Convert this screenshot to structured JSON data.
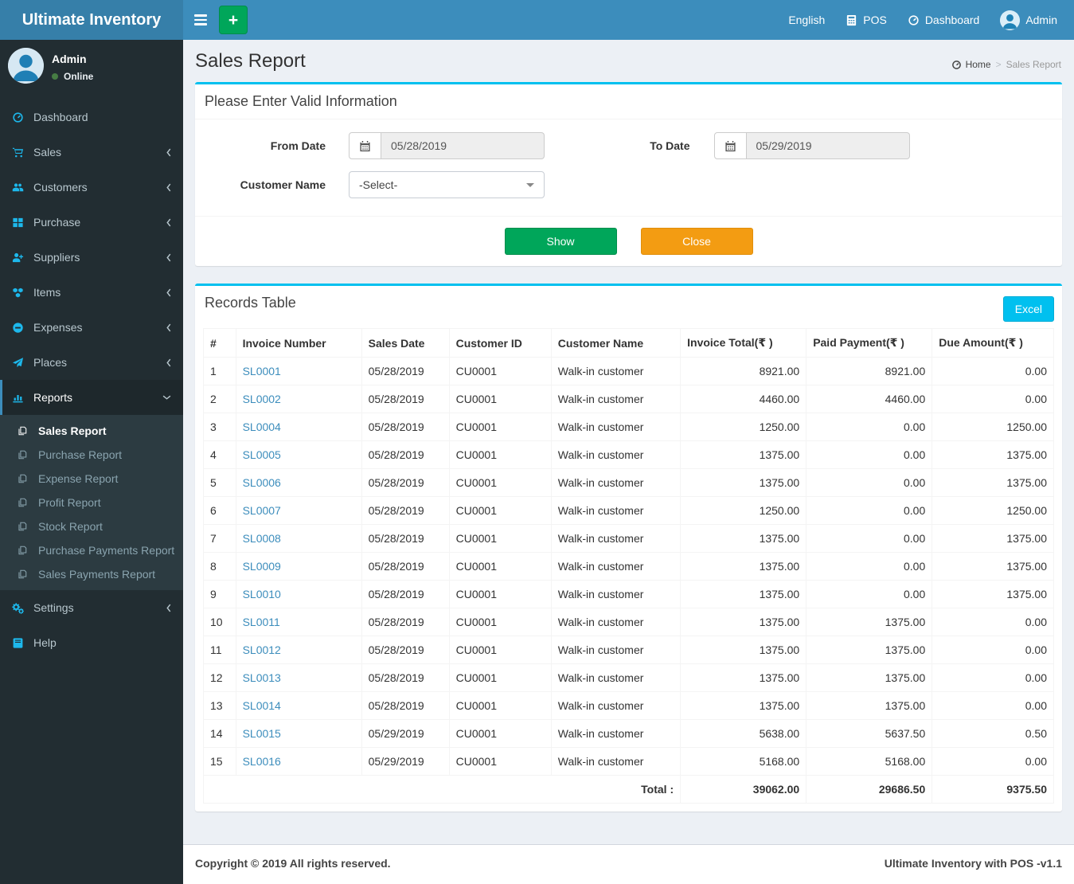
{
  "navbar": {
    "brand": "Ultimate Inventory",
    "right": {
      "language": "English",
      "pos": "POS",
      "dashboard": "Dashboard",
      "user": "Admin"
    }
  },
  "sidebar": {
    "user_name": "Admin",
    "user_status": "Online",
    "menu": [
      {
        "label": "Dashboard",
        "icon": "tachometer-icon",
        "expandable": false
      },
      {
        "label": "Sales",
        "icon": "cart-icon",
        "expandable": true
      },
      {
        "label": "Customers",
        "icon": "users-icon",
        "expandable": true
      },
      {
        "label": "Purchase",
        "icon": "grid-icon",
        "expandable": true
      },
      {
        "label": "Suppliers",
        "icon": "user-plus-icon",
        "expandable": true
      },
      {
        "label": "Items",
        "icon": "cubes-icon",
        "expandable": true
      },
      {
        "label": "Expenses",
        "icon": "minus-circle-icon",
        "expandable": true
      },
      {
        "label": "Places",
        "icon": "send-icon",
        "expandable": true
      },
      {
        "label": "Reports",
        "icon": "bar-chart-icon",
        "expandable": true,
        "active": true,
        "expanded": true,
        "submenu": [
          {
            "label": "Sales Report",
            "active": true
          },
          {
            "label": "Purchase Report"
          },
          {
            "label": "Expense Report"
          },
          {
            "label": "Profit Report"
          },
          {
            "label": "Stock Report"
          },
          {
            "label": "Purchase Payments Report"
          },
          {
            "label": "Sales Payments Report"
          }
        ]
      },
      {
        "label": "Settings",
        "icon": "gears-icon",
        "expandable": true
      },
      {
        "label": "Help",
        "icon": "book-icon",
        "expandable": false
      }
    ]
  },
  "page": {
    "title": "Sales Report",
    "breadcrumb": {
      "home": "Home",
      "current": "Sales Report"
    }
  },
  "filter_box": {
    "header": "Please Enter Valid Information",
    "from_date_label": "From Date",
    "from_date_value": "05/28/2019",
    "to_date_label": "To Date",
    "to_date_value": "05/29/2019",
    "customer_label": "Customer Name",
    "customer_value": "-Select-",
    "show_button": "Show",
    "close_button": "Close"
  },
  "records_box": {
    "header": "Records Table",
    "excel_button": "Excel",
    "columns": [
      "#",
      "Invoice Number",
      "Sales Date",
      "Customer ID",
      "Customer Name",
      "Invoice Total(₹ )",
      "Paid Payment(₹ )",
      "Due Amount(₹ )"
    ],
    "rows": [
      [
        "1",
        "SL0001",
        "05/28/2019",
        "CU0001",
        "Walk-in customer",
        "8921.00",
        "8921.00",
        "0.00"
      ],
      [
        "2",
        "SL0002",
        "05/28/2019",
        "CU0001",
        "Walk-in customer",
        "4460.00",
        "4460.00",
        "0.00"
      ],
      [
        "3",
        "SL0004",
        "05/28/2019",
        "CU0001",
        "Walk-in customer",
        "1250.00",
        "0.00",
        "1250.00"
      ],
      [
        "4",
        "SL0005",
        "05/28/2019",
        "CU0001",
        "Walk-in customer",
        "1375.00",
        "0.00",
        "1375.00"
      ],
      [
        "5",
        "SL0006",
        "05/28/2019",
        "CU0001",
        "Walk-in customer",
        "1375.00",
        "0.00",
        "1375.00"
      ],
      [
        "6",
        "SL0007",
        "05/28/2019",
        "CU0001",
        "Walk-in customer",
        "1250.00",
        "0.00",
        "1250.00"
      ],
      [
        "7",
        "SL0008",
        "05/28/2019",
        "CU0001",
        "Walk-in customer",
        "1375.00",
        "0.00",
        "1375.00"
      ],
      [
        "8",
        "SL0009",
        "05/28/2019",
        "CU0001",
        "Walk-in customer",
        "1375.00",
        "0.00",
        "1375.00"
      ],
      [
        "9",
        "SL0010",
        "05/28/2019",
        "CU0001",
        "Walk-in customer",
        "1375.00",
        "0.00",
        "1375.00"
      ],
      [
        "10",
        "SL0011",
        "05/28/2019",
        "CU0001",
        "Walk-in customer",
        "1375.00",
        "1375.00",
        "0.00"
      ],
      [
        "11",
        "SL0012",
        "05/28/2019",
        "CU0001",
        "Walk-in customer",
        "1375.00",
        "1375.00",
        "0.00"
      ],
      [
        "12",
        "SL0013",
        "05/28/2019",
        "CU0001",
        "Walk-in customer",
        "1375.00",
        "1375.00",
        "0.00"
      ],
      [
        "13",
        "SL0014",
        "05/28/2019",
        "CU0001",
        "Walk-in customer",
        "1375.00",
        "1375.00",
        "0.00"
      ],
      [
        "14",
        "SL0015",
        "05/29/2019",
        "CU0001",
        "Walk-in customer",
        "5638.00",
        "5637.50",
        "0.50"
      ],
      [
        "15",
        "SL0016",
        "05/29/2019",
        "CU0001",
        "Walk-in customer",
        "5168.00",
        "5168.00",
        "0.00"
      ]
    ],
    "total_label": "Total :",
    "totals": [
      "39062.00",
      "29686.50",
      "9375.50"
    ]
  },
  "footer": {
    "left": "Copyright © 2019 All rights reserved.",
    "right": "Ultimate Inventory with POS -v1.1"
  },
  "colors": {
    "navbar": "#3c8dbc",
    "logo_bg": "#367fa9",
    "sidebar_bg": "#222d32",
    "submenu_bg": "#2c3b41",
    "accent_cyan": "#00c0ef",
    "green": "#00a65a",
    "orange": "#f39c12",
    "link": "#3c8dbc"
  }
}
